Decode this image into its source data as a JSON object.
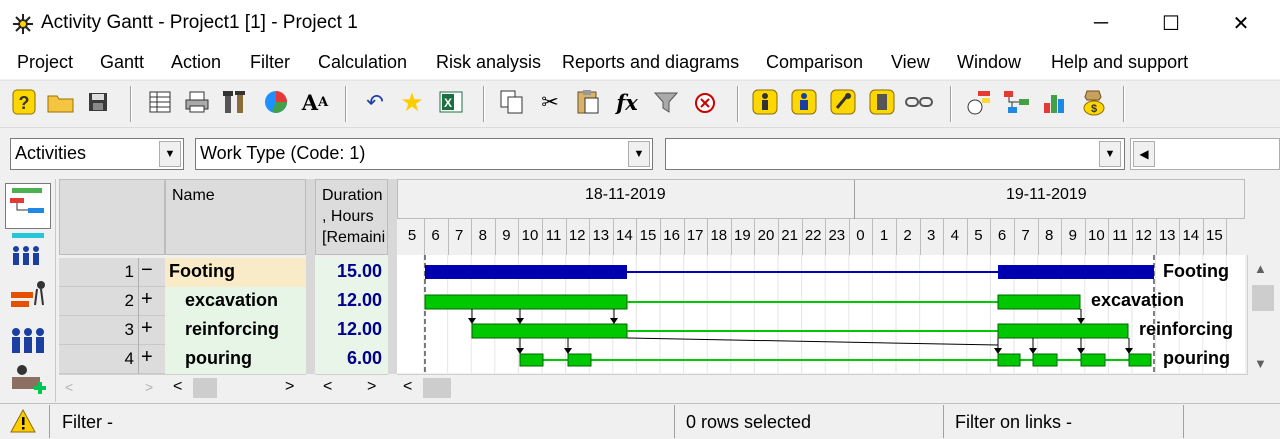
{
  "window": {
    "title": "Activity Gantt - Project1 [1] - Project 1",
    "minimize": "─",
    "maximize": "☐",
    "close": "✕"
  },
  "menu": [
    "Project",
    "Gantt",
    "Action",
    "Filter",
    "Calculation",
    "Risk analysis",
    "Reports and diagrams",
    "Comparison",
    "View",
    "Window",
    "Help and support"
  ],
  "filters": {
    "view_select": "Activities",
    "code_select": "Work Type (Code: 1)",
    "value_select": ""
  },
  "columns": {
    "name": "Name",
    "duration_l1": "Duration",
    "duration_l2": ", Hours",
    "duration_l3": "[Remaini"
  },
  "dates": [
    "18-11-2019",
    "19-11-2019"
  ],
  "hours_day1": [
    "5",
    "6",
    "7",
    "8",
    "9",
    "10",
    "11",
    "12",
    "13",
    "14",
    "15",
    "16",
    "17",
    "18",
    "19",
    "20",
    "21",
    "22",
    "23"
  ],
  "hours_day2": [
    "0",
    "1",
    "2",
    "3",
    "4",
    "5",
    "6",
    "7",
    "8",
    "9",
    "10",
    "11",
    "12",
    "13",
    "14",
    "15"
  ],
  "rows": [
    {
      "num": "1",
      "expander": "−",
      "name": "Footing",
      "duration": "15.00",
      "label": "Footing"
    },
    {
      "num": "2",
      "expander": "+",
      "name": "excavation",
      "duration": "12.00",
      "label": "excavation"
    },
    {
      "num": "3",
      "expander": "+",
      "name": "reinforcing",
      "duration": "12.00",
      "label": "reinforcing"
    },
    {
      "num": "4",
      "expander": "+",
      "name": "pouring",
      "duration": "6.00",
      "label": "pouring"
    }
  ],
  "status": {
    "filter": "Filter -",
    "rows_selected": "0 rows selected",
    "filter_links": "Filter on links -"
  },
  "colors": {
    "summary_bar": "#0000b0",
    "task_bar": "#00c800",
    "footing_row_bg": "#faebc8",
    "task_row_bg": "#e6f5e6"
  }
}
